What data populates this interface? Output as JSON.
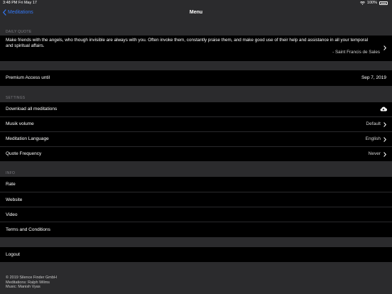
{
  "status_bar": {
    "time_date": "3:48 PM   Fri May 17",
    "battery": "100%"
  },
  "nav": {
    "back_label": "Meditations",
    "title": "Menu"
  },
  "daily_quote": {
    "header": "DAILY QUOTE",
    "text": "Make friends with the angels, who though invisible are always with you. Often invoke them, constantly praise them, and make good use of their help and assistance in all your temporal and spiritual affairs.",
    "author": "- Saint Francis de Sales"
  },
  "premium": {
    "label": "Premium Access until",
    "value": "Sep 7, 2019"
  },
  "settings": {
    "header": "SETTINGS",
    "download_label": "Download all meditations",
    "musik_label": "Musik volume",
    "musik_value": "Default",
    "language_label": "Meditation Language",
    "language_value": "English",
    "quote_freq_label": "Quote Frequency",
    "quote_freq_value": "Never"
  },
  "info": {
    "header": "INFO",
    "items": [
      "Rate",
      "Website",
      "Video",
      "Terms and Conditions"
    ]
  },
  "logout_label": "Logout",
  "footer": {
    "line1": "© 2019 Silence Finder GmbH",
    "line2": "Meditations: Ralph Wilms",
    "line3": "Music: Manish Vyas"
  },
  "icons": {
    "back": "chevron-left-icon",
    "chevron": "chevron-right-icon",
    "download": "cloud-download-icon",
    "wifi": "wifi-icon",
    "battery": "battery-icon"
  },
  "colors": {
    "accent": "#3478f6",
    "background": "#2b2b2d",
    "cell": "#000000",
    "header_text": "#7d7d82"
  }
}
